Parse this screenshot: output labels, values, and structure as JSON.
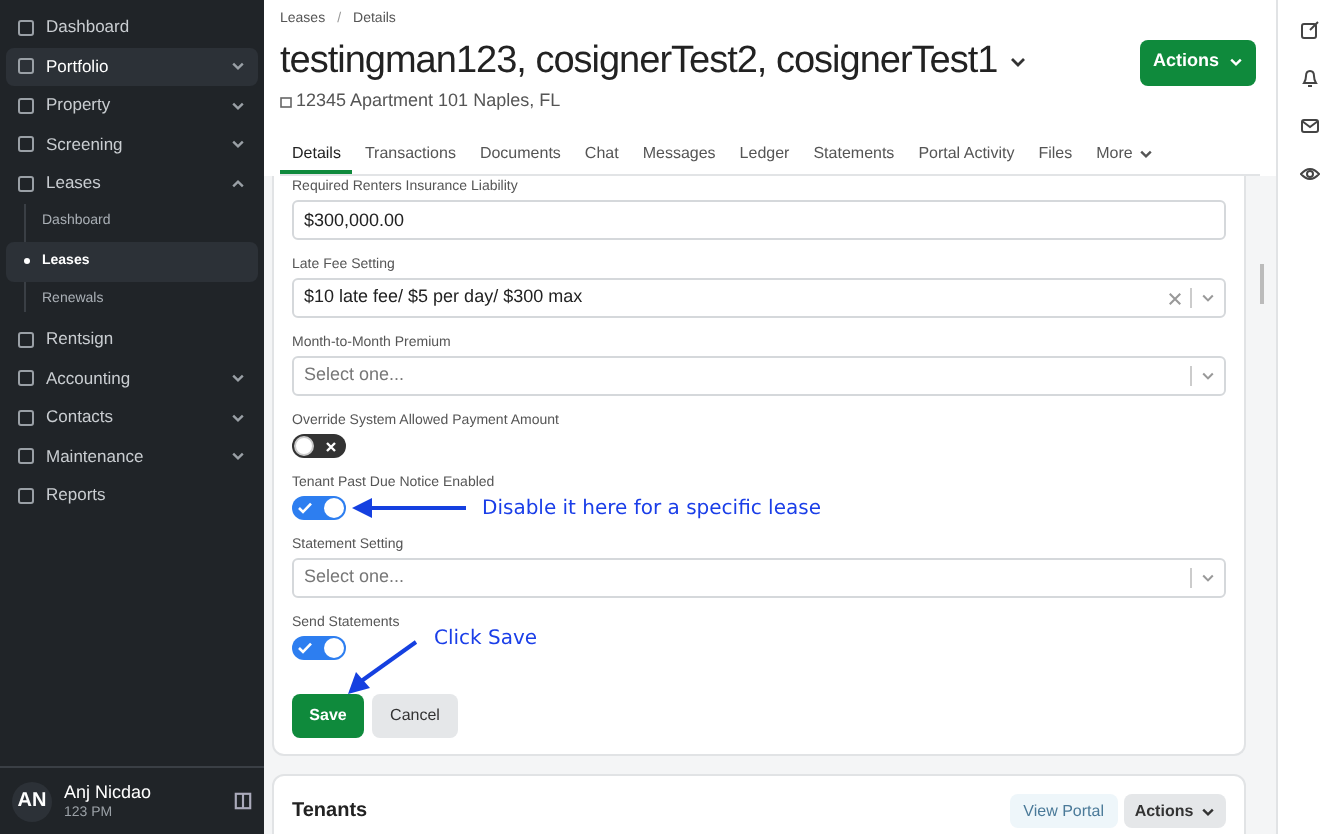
{
  "sidebar": {
    "items": [
      {
        "label": "Dashboard",
        "selected": false,
        "expandable": false
      },
      {
        "label": "Portfolio",
        "selected": true,
        "expandable": true,
        "expanded": false
      },
      {
        "label": "Property",
        "selected": false,
        "expandable": true,
        "expanded": false
      },
      {
        "label": "Screening",
        "selected": false,
        "expandable": true,
        "expanded": false
      },
      {
        "label": "Leases",
        "selected": false,
        "expandable": true,
        "expanded": true,
        "children": [
          {
            "label": "Dashboard",
            "selected": false
          },
          {
            "label": "Leases",
            "selected": true
          },
          {
            "label": "Renewals",
            "selected": false
          }
        ]
      },
      {
        "label": "Rentsign",
        "selected": false,
        "expandable": false
      },
      {
        "label": "Accounting",
        "selected": false,
        "expandable": true,
        "expanded": false
      },
      {
        "label": "Contacts",
        "selected": false,
        "expandable": true,
        "expanded": false
      },
      {
        "label": "Maintenance",
        "selected": false,
        "expandable": true,
        "expanded": false
      },
      {
        "label": "Reports",
        "selected": false,
        "expandable": false
      }
    ],
    "user": {
      "initials": "AN",
      "name": "Anj Nicdao",
      "time": "123 PM"
    }
  },
  "breadcrumb": [
    "Leases",
    "Details"
  ],
  "breadcrumb_separator": "/",
  "title": "testingman123, cosignerTest2, cosignerTest1",
  "address": "12345 Apartment 101 Naples, FL",
  "actions_button": "Actions",
  "tabs": [
    {
      "label": "Details",
      "selected": true
    },
    {
      "label": "Transactions",
      "selected": false
    },
    {
      "label": "Documents",
      "selected": false
    },
    {
      "label": "Chat",
      "selected": false
    },
    {
      "label": "Messages",
      "selected": false
    },
    {
      "label": "Ledger",
      "selected": false
    },
    {
      "label": "Statements",
      "selected": false
    },
    {
      "label": "Portal Activity",
      "selected": false
    },
    {
      "label": "Files",
      "selected": false
    },
    {
      "label": "More",
      "selected": false
    }
  ],
  "form": [
    {
      "kind": "input",
      "label": "Required Renters Insurance Liability",
      "value": "$300,000.00"
    },
    {
      "kind": "select",
      "label": "Late Fee Setting",
      "value": "$10 late fee/ $5 per day/ $300 max",
      "clearable": true
    },
    {
      "kind": "select",
      "label": "Month-to-Month Premium",
      "placeholder": "Select one..."
    },
    {
      "kind": "toggle",
      "label": "Override System Allowed Payment Amount",
      "on": false
    },
    {
      "kind": "toggle",
      "label": "Tenant Past Due Notice Enabled",
      "on": true,
      "annotation": "Disable it here for a specific lease"
    },
    {
      "kind": "select",
      "label": "Statement Setting",
      "placeholder": "Select one..."
    },
    {
      "kind": "toggle",
      "label": "Send Statements",
      "on": true
    }
  ],
  "save_button": "Save",
  "save_annotation": "Click Save",
  "cancel_button": "Cancel",
  "tenants": {
    "title": "Tenants",
    "view_portal": "View Portal",
    "actions": "Actions"
  }
}
